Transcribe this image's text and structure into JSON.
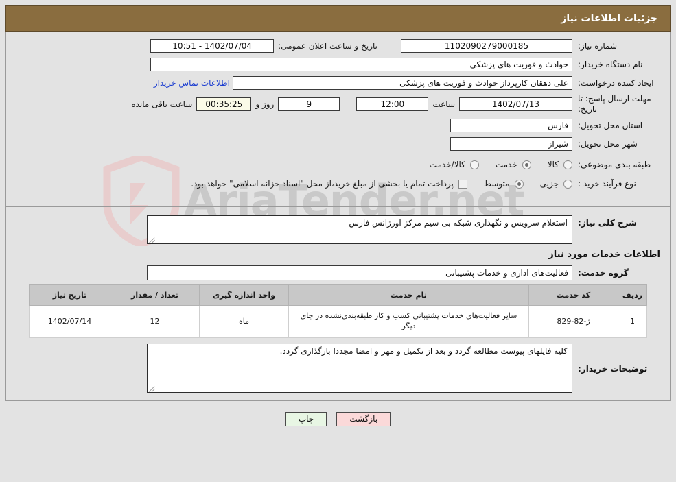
{
  "header": {
    "title": "جزئیات اطلاعات نیاز",
    "bar_color": "#8a6d3f"
  },
  "watermark": {
    "text": "AriaTender",
    "tld": ".net"
  },
  "summary": {
    "need_number_label": "شماره نیاز:",
    "need_number_value": "1102090279000185",
    "public_announce_label": "تاریخ و ساعت اعلان عمومی:",
    "public_announce_value": "1402/07/04 - 10:51",
    "buyer_org_label": "نام دستگاه خریدار:",
    "buyer_org_value": "حوادث و فوریت های پزشکی",
    "buyer_org_extra_value": "",
    "creator_label": "ایجاد کننده درخواست:",
    "creator_value": "علی دهقان کارپرداز حوادث و فوریت های پزشکی",
    "contact_link": "اطلاعات تماس خریدار",
    "deadline_label": "مهلت ارسال پاسخ: تا تاریخ:",
    "deadline_date": "1402/07/13",
    "hour_label": "ساعت",
    "deadline_time": "12:00",
    "days_value": "9",
    "days_label": "روز و",
    "countdown_value": "00:35:25",
    "countdown_label": "ساعت باقی مانده",
    "province_label": "استان محل تحویل:",
    "province_value": "فارس",
    "city_label": "شهر محل تحویل:",
    "city_value": "شیراز",
    "category_label": "طبقه بندی موضوعی:",
    "category_options": [
      {
        "label": "کالا",
        "selected": false
      },
      {
        "label": "خدمت",
        "selected": true
      },
      {
        "label": "کالا/خدمت",
        "selected": false
      }
    ],
    "process_label": "نوع فرآیند خرید :",
    "process_options": [
      {
        "label": "جزیی",
        "selected": false
      },
      {
        "label": "متوسط",
        "selected": true
      }
    ],
    "treasury_checkbox_checked": false,
    "treasury_text": "پرداخت تمام یا بخشی از مبلغ خرید،از محل \"اسناد خزانه اسلامی\" خواهد بود."
  },
  "need_summary": {
    "label": "شرح کلی نیاز:",
    "value": "استعلام سرویس و نگهداری شبکه بی سیم مرکز اورژانس فارس"
  },
  "services_section": {
    "heading": "اطلاعات خدمات مورد نیاز",
    "group_label": "گروه خدمت:",
    "group_value": "فعالیت‌های اداری و خدمات پشتیبانی"
  },
  "table": {
    "columns": [
      "ردیف",
      "کد خدمت",
      "نام خدمت",
      "واحد اندازه گیری",
      "تعداد / مقدار",
      "تاریخ نیاز"
    ],
    "rows": [
      {
        "radif": "1",
        "code": "ژ-82-829",
        "name": "سایر فعالیت‌های خدمات پشتیبانی کسب و کار طبقه‌بندی‌نشده در جای دیگر",
        "unit": "ماه",
        "qty": "12",
        "date": "1402/07/14"
      }
    ]
  },
  "buyer_notes": {
    "label": "توضیحات خریدار:",
    "value": "کلیه فایلهای پیوست مطالعه گردد و بعد از تکمیل و مهر و امضا مجددا بارگذاری گردد."
  },
  "footer": {
    "print_label": "چاپ",
    "back_label": "بازگشت",
    "print_color": "#e8f6e4",
    "back_color": "#fbd9d9"
  }
}
